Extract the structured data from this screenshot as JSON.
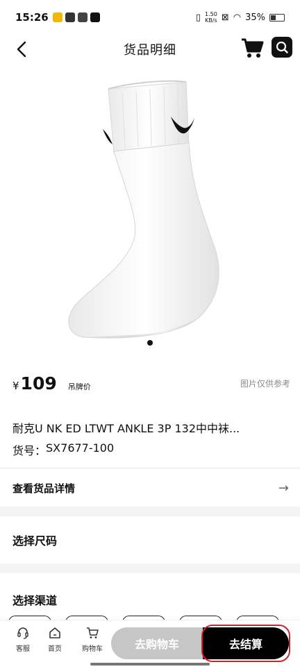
{
  "status_bar": {
    "time": "15:26",
    "speed_value": "1.50",
    "speed_unit": "KB/s",
    "battery": "35%"
  },
  "header": {
    "title": "货品明细"
  },
  "product": {
    "currency": "¥",
    "price": "109",
    "price_label": "吊牌价",
    "image_note": "图片仅供参考",
    "name": "耐克U NK ED LTWT ANKLE 3P 132中中袜...",
    "sku_label": "货号：",
    "sku": "SX7677-100",
    "carousel_index": 1,
    "carousel_total": 1
  },
  "details": {
    "label": "查看货品详情"
  },
  "sections": {
    "size_title": "选择尺码",
    "channel_title": "选择渠道"
  },
  "bottom_nav": {
    "service": "客服",
    "home": "首页",
    "cart": "购物车",
    "add_to_cart": "去购物车",
    "checkout": "去结算"
  },
  "colors": {
    "accent_highlight": "#f5b47a",
    "checkout_bg": "#000000",
    "add_to_cart_bg": "#c6c6c6",
    "annotation_outline": "#d81e2a"
  }
}
